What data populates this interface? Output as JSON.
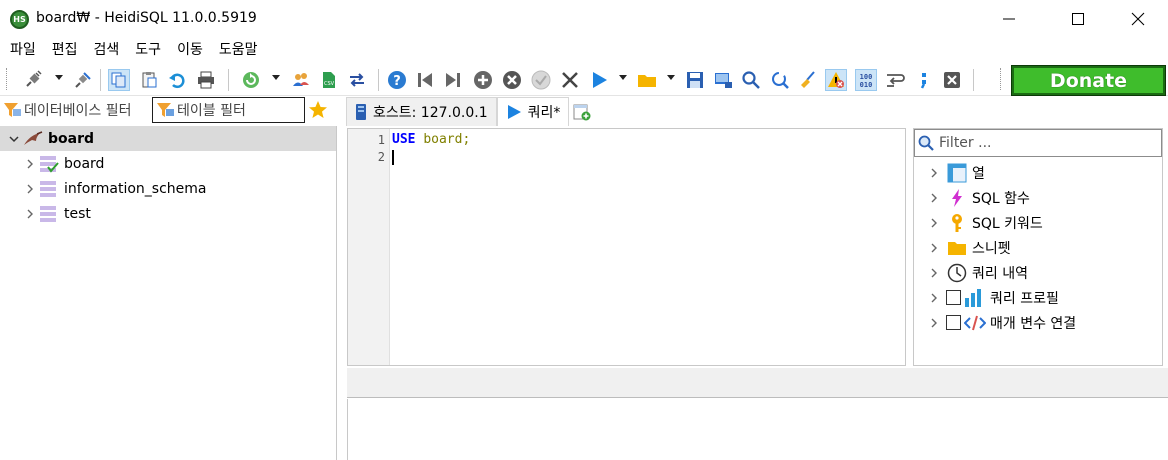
{
  "window": {
    "title": "board₩ - HeidiSQL 11.0.0.5919",
    "app_icon_text": "HS"
  },
  "menu": [
    "파일",
    "편집",
    "검색",
    "도구",
    "이동",
    "도움말"
  ],
  "toolbar": {
    "donate_label": "Donate"
  },
  "filters": {
    "database_placeholder": "데이터베이스 필터",
    "table_placeholder": "테이블 필터"
  },
  "tabs": [
    {
      "label": "호스트: 127.0.0.1",
      "icon": "host-icon"
    },
    {
      "label": "쿼리*",
      "icon": "play-icon"
    }
  ],
  "tree": {
    "root": "board",
    "children": [
      "board",
      "information_schema",
      "test"
    ]
  },
  "editor": {
    "line_numbers": [
      "1",
      "2"
    ],
    "line1_keyword": "USE",
    "line1_identifier": "board",
    "line1_terminator": ";"
  },
  "helper": {
    "filter_placeholder": "Filter ...",
    "items": [
      {
        "label": "열",
        "icon": "columns-icon",
        "checkbox": false
      },
      {
        "label": "SQL 함수",
        "icon": "lightning-icon",
        "checkbox": false
      },
      {
        "label": "SQL 키워드",
        "icon": "key-icon",
        "checkbox": false
      },
      {
        "label": "스니펫",
        "icon": "folder-icon",
        "checkbox": false
      },
      {
        "label": "쿼리 내역",
        "icon": "clock-icon",
        "checkbox": false
      },
      {
        "label": "쿼리 프로필",
        "icon": "bar-chart-icon",
        "checkbox": true
      },
      {
        "label": "매개 변수 연결",
        "icon": "code-tag-icon",
        "checkbox": true
      }
    ]
  },
  "colors": {
    "donate_bg": "#3fbd2c",
    "keyword": "#0000ff",
    "identifier": "#808000",
    "tree_selected": "#dadada"
  }
}
